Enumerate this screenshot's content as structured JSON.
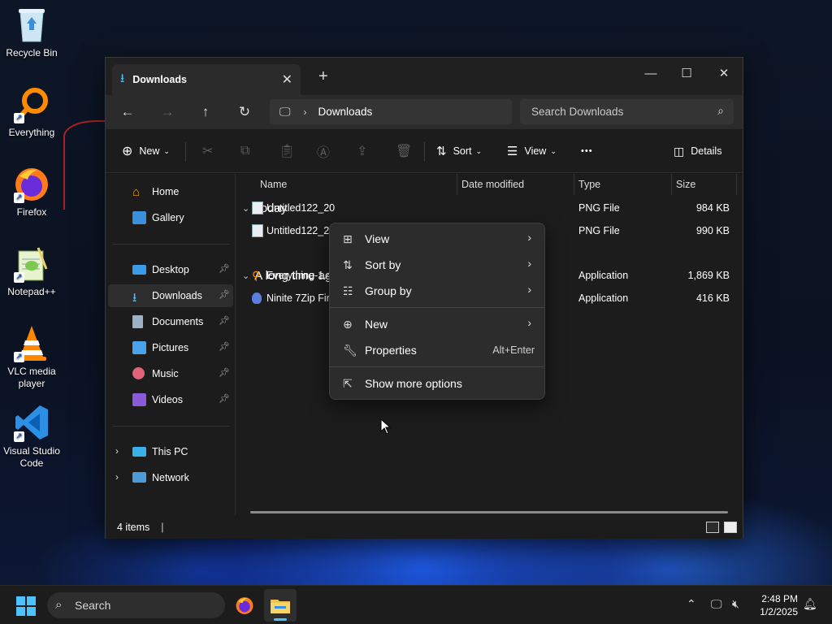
{
  "desktop": {
    "icons": [
      {
        "label": "Recycle Bin"
      },
      {
        "label": "Everything"
      },
      {
        "label": "Firefox"
      },
      {
        "label": "Notepad++"
      },
      {
        "label": "VLC media player"
      },
      {
        "label": "Visual Studio Code"
      }
    ]
  },
  "window": {
    "tab_title": "Downloads",
    "new_tab": "+",
    "address": {
      "crumb": "Downloads"
    },
    "search": {
      "placeholder": "Search Downloads"
    },
    "toolbar": {
      "new_label": "New",
      "sort_label": "Sort",
      "view_label": "View",
      "more_label": "•••",
      "details_label": "Details"
    },
    "sidebar": {
      "items": [
        {
          "label": "Home"
        },
        {
          "label": "Gallery"
        },
        {
          "label": "Desktop"
        },
        {
          "label": "Downloads"
        },
        {
          "label": "Documents"
        },
        {
          "label": "Pictures"
        },
        {
          "label": "Music"
        },
        {
          "label": "Videos"
        },
        {
          "label": "This PC"
        },
        {
          "label": "Network"
        }
      ]
    },
    "columns": {
      "name": "Name",
      "date": "Date modified",
      "type": "Type",
      "size": "Size"
    },
    "groups": [
      {
        "label": "Today"
      },
      {
        "label": "A long time ago"
      }
    ],
    "files": [
      {
        "name": "Untitled122_20",
        "type": "PNG File",
        "size": "984 KB"
      },
      {
        "name": "Untitled122_20",
        "type": "PNG File",
        "size": "990 KB"
      },
      {
        "name": "Everything-1.4",
        "type": "Application",
        "size": "1,869 KB"
      },
      {
        "name": "Ninite 7Zip Fire",
        "type": "Application",
        "size": "416 KB"
      }
    ],
    "status": {
      "item_count": "4 items",
      "caret": "|"
    }
  },
  "context_menu": {
    "items": [
      {
        "label": "View",
        "icon": "grid-icon",
        "submenu": true
      },
      {
        "label": "Sort by",
        "icon": "sort-icon",
        "submenu": true
      },
      {
        "label": "Group by",
        "icon": "list-icon",
        "submenu": true
      },
      {
        "label": "New",
        "icon": "plus-circle-icon",
        "submenu": true
      },
      {
        "label": "Properties",
        "icon": "wrench-icon",
        "accelerator": "Alt+Enter"
      },
      {
        "label": "Show more options",
        "icon": "share-icon"
      }
    ]
  },
  "taskbar": {
    "search_label": "Search",
    "time": "2:48 PM",
    "date": "1/2/2025"
  },
  "colors": {
    "accent": "#4cc2ff",
    "window_bg": "#1c1c1c",
    "menu_bg": "#2c2c2c"
  }
}
